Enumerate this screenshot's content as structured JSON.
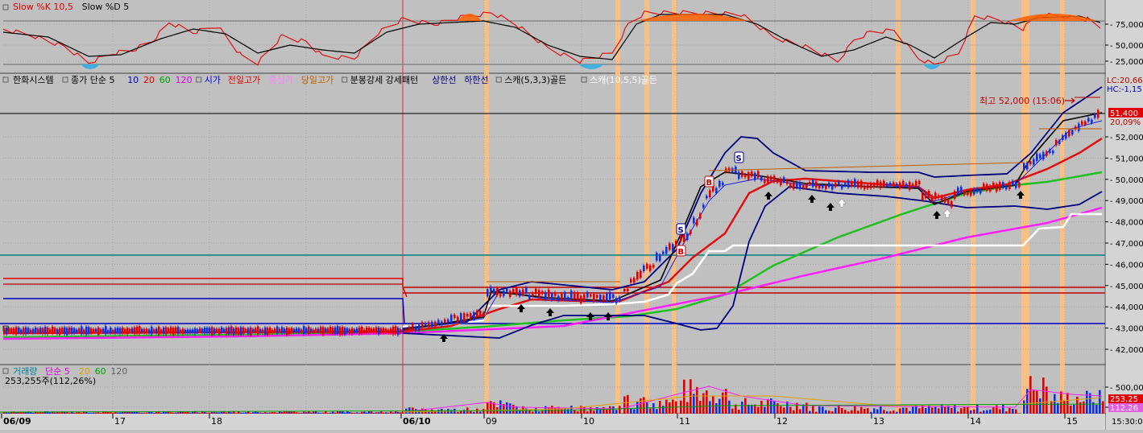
{
  "stoch": {
    "legend": [
      {
        "text": "Slow %K 10,5",
        "color": "#e00000"
      },
      {
        "text": "Slow %D 5",
        "color": "#000000"
      }
    ],
    "ticks": [
      "75,000",
      "50,000",
      "25,000"
    ]
  },
  "price": {
    "legend": [
      {
        "text": "한화시스템",
        "color": "#000000"
      },
      {
        "text": "종가 단순 5",
        "color": "#000000"
      },
      {
        "text": "10",
        "color": "#0000cc"
      },
      {
        "text": "20",
        "color": "#e00000"
      },
      {
        "text": "60",
        "color": "#00a000"
      },
      {
        "text": "120",
        "color": "#e000e0"
      },
      {
        "text": "시가",
        "color": "#0000ff"
      },
      {
        "text": "전일고가",
        "color": "#e00000"
      },
      {
        "text": "중심가",
        "color": "#ff80ff"
      },
      {
        "text": "당일고가",
        "color": "#c06000"
      },
      {
        "text": "분봉강세 강세패턴",
        "color": "#000000"
      },
      {
        "text": "상한선",
        "color": "#000080"
      },
      {
        "text": "하한선",
        "color": "#000080"
      },
      {
        "text": "스캐(5,3,3)골든",
        "color": "#000000"
      },
      {
        "text": "스캐(10,5,5)골든",
        "color": "#ffffff"
      }
    ],
    "ticks": [
      "52,000",
      "51,000",
      "50,000",
      "49,000",
      "48,000",
      "47,000",
      "46,000",
      "45,000",
      "44,000",
      "43,000",
      "42,000"
    ],
    "lc_label": "LC:20,66",
    "hc_label": "HC:-1,15",
    "current_price": "51,400",
    "current_pct": "20,09%",
    "high_annotation": "최고 52,000 (15:06)"
  },
  "volume": {
    "legend": [
      {
        "text": "거래량",
        "color": "#0080a0"
      },
      {
        "text": "단순 5",
        "color": "#e000e0"
      },
      {
        "text": "20",
        "color": "#e0a000"
      },
      {
        "text": "60",
        "color": "#00a000"
      },
      {
        "text": "120",
        "color": "#606060"
      }
    ],
    "value_label": "253,255주(112,26%)",
    "ticks": [
      "500,000",
      "250,000"
    ],
    "box_top": "253,25",
    "box_bottom": "112,26"
  },
  "time_axis": {
    "labels": [
      "06/09",
      "17",
      "18",
      "06/10",
      "09",
      "10",
      "11",
      "12",
      "13",
      "14",
      "15"
    ],
    "end_label": "15:30:00"
  }
}
